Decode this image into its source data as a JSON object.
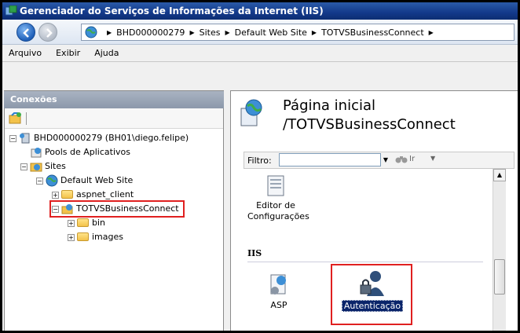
{
  "window": {
    "title": "Gerenciador do Serviços de Informações da Internet (IIS)"
  },
  "address": {
    "crumbs": [
      "BHD000000279",
      "Sites",
      "Default Web Site",
      "TOTVSBusinessConnect"
    ]
  },
  "menu": {
    "items": [
      "Arquivo",
      "Exibir",
      "Ajuda"
    ]
  },
  "connections": {
    "header": "Conexões",
    "tree": [
      {
        "label": "BHD000000279 (BH01\\diego.felipe)",
        "expanded": true
      },
      {
        "label": "Pools de Aplicativos"
      },
      {
        "label": "Sites",
        "expanded": true
      },
      {
        "label": "Default Web Site",
        "expanded": true
      },
      {
        "label": "aspnet_client",
        "expanded": false
      },
      {
        "label": "TOTVSBusinessConnect",
        "expanded": true,
        "selected": true
      },
      {
        "label": "bin",
        "expanded": false
      },
      {
        "label": "images",
        "expanded": false
      }
    ]
  },
  "main": {
    "title_line1": "Página inicial",
    "title_line2": "/TOTVSBusinessConnect",
    "filter": {
      "label": "Filtro:",
      "go_label": "Ir"
    },
    "features": {
      "config_editor_line1": "Editor de",
      "config_editor_line2": "Configurações",
      "section_iis": "IIS",
      "asp": "ASP",
      "auth": "Autenticação"
    }
  },
  "colors": {
    "titlebar": "#13398a",
    "highlight_border": "#e02020",
    "selection": "#0a246a"
  }
}
